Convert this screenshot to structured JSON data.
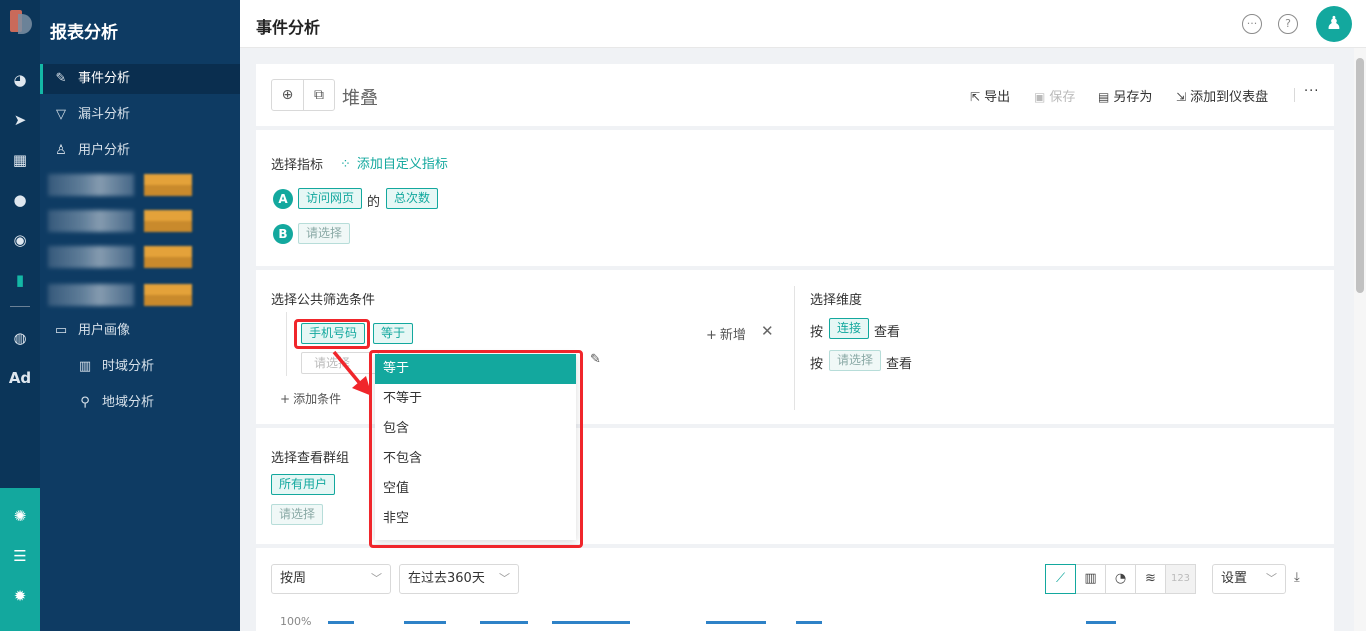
{
  "sidebar": {
    "title": "报表分析",
    "items": [
      {
        "label": "事件分析"
      },
      {
        "label": "漏斗分析"
      },
      {
        "label": "用户分析"
      },
      {
        "label": "用户画像"
      },
      {
        "label": "时域分析"
      },
      {
        "label": "地域分析"
      }
    ]
  },
  "rail": {
    "ad_label": "Ad"
  },
  "header": {
    "title": "事件分析"
  },
  "report": {
    "name": "堆叠",
    "actions": {
      "export": "导出",
      "save": "保存",
      "save_as": "另存为",
      "add_to_dashboard": "添加到仪表盘",
      "more": "···"
    }
  },
  "metrics": {
    "section_label": "选择指标",
    "add_custom": "添加自定义指标",
    "row_a": {
      "badge": "A",
      "event": "访问网页",
      "connector": "的",
      "measure": "总次数"
    },
    "row_b": {
      "badge": "B",
      "placeholder": "请选择"
    }
  },
  "filters": {
    "section_label": "选择公共筛选条件",
    "field": "手机号码",
    "operator": "等于",
    "value_placeholder": "请选择",
    "add_new": "新增",
    "add_condition": "添加条件"
  },
  "dimensions": {
    "section_label": "选择维度",
    "row1": {
      "prefix": "按",
      "value": "连接",
      "suffix": "查看"
    },
    "row2": {
      "prefix": "按",
      "value": "请选择",
      "suffix": "查看"
    }
  },
  "groups": {
    "section_label": "选择查看群组",
    "all_users": "所有用户",
    "placeholder": "请选择"
  },
  "operator_dropdown": {
    "options": [
      "等于",
      "不等于",
      "包含",
      "不包含",
      "空值",
      "非空"
    ],
    "selected_index": 0
  },
  "chart_toolbar": {
    "granularity": "按周",
    "range": "在过去360天",
    "numeric_btn": "123",
    "settings": "设置",
    "y_top_label": "100%"
  },
  "colors": {
    "accent": "#13a89e",
    "sidebar": "#0e3b63",
    "highlight": "#f0262b"
  }
}
